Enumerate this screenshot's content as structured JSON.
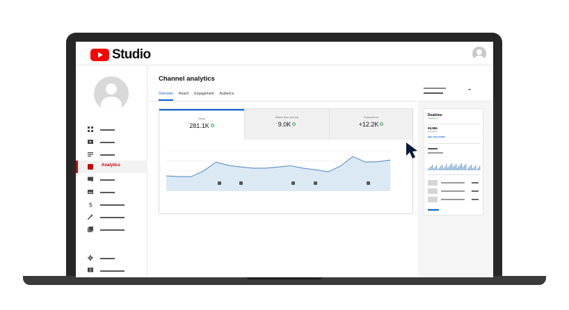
{
  "app": {
    "logo_text": "Studio",
    "brand_color": "#ff0000",
    "accent_color": "#065fd4",
    "active_nav_color": "#cc0000"
  },
  "sidebar": {
    "items": [
      {
        "icon": "dashboard-icon"
      },
      {
        "icon": "content-icon"
      },
      {
        "icon": "playlists-icon"
      },
      {
        "icon": "analytics-icon",
        "label": "Analytics",
        "active": true
      },
      {
        "icon": "comments-icon"
      },
      {
        "icon": "subtitles-icon"
      },
      {
        "icon": "monetization-icon"
      },
      {
        "icon": "customization-icon"
      },
      {
        "icon": "audio-library-icon"
      },
      {
        "icon": "settings-icon"
      },
      {
        "icon": "feedback-icon"
      }
    ]
  },
  "header": {
    "title": "Channel analytics",
    "tabs": [
      {
        "label": "Overview",
        "active": true
      },
      {
        "label": "Reach"
      },
      {
        "label": "Engagement"
      },
      {
        "label": "Audience"
      }
    ]
  },
  "metrics": [
    {
      "label": "Views",
      "value": "281.1K"
    },
    {
      "label": "Watch time (hours)",
      "value": "9.0K"
    },
    {
      "label": "Subscribers",
      "value": "+12.2K"
    }
  ],
  "chart_data": {
    "type": "area",
    "series": [
      {
        "values": [
          0.38,
          0.36,
          0.36,
          0.5,
          0.72,
          0.64,
          0.6,
          0.57,
          0.57,
          0.6,
          0.63,
          0.57,
          0.53,
          0.48,
          0.62,
          0.86,
          0.72,
          0.73,
          0.77
        ]
      }
    ],
    "grid": true,
    "event_markers": 6
  },
  "realtime": {
    "title": "Realtime",
    "status": "Updating live",
    "count": "99,886",
    "count_label": "Subscribers",
    "link_label": "SEE LIVE COUNT"
  }
}
